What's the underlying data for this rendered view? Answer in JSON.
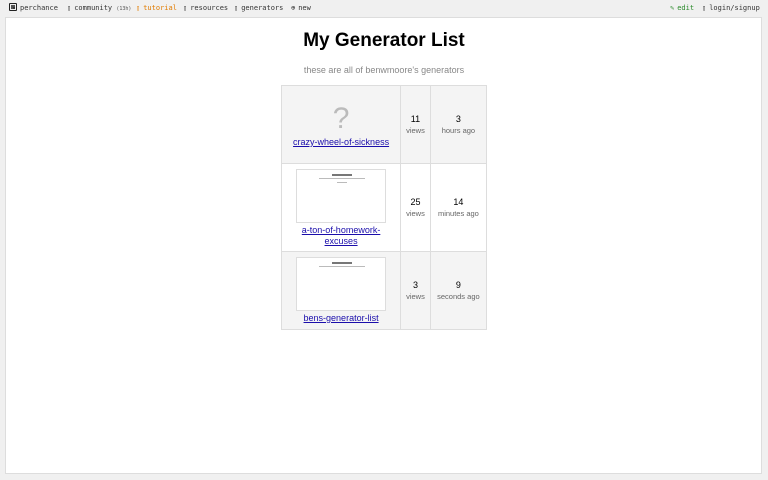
{
  "topbar": {
    "logo_label": "perchance",
    "community_label": "community",
    "community_count": "(13h)",
    "tutorial_label": "tutorial",
    "resources_label": "resources",
    "generators_label": "generators",
    "new_label": "new",
    "edit_label": "edit",
    "login_label": "login/signup",
    "icons": {
      "logo": "dice-icon",
      "community": "chat-icon",
      "tutorial": "book-icon",
      "resources": "list-icon",
      "generators": "list-icon",
      "new": "plus-circle-icon",
      "edit": "pencil-icon",
      "login": "user-icon"
    },
    "colors": {
      "tutorial": "#e07b00",
      "edit": "#2a8a2a"
    }
  },
  "page": {
    "title": "My Generator List",
    "subtitle": "these are all of benwmoore's generators"
  },
  "generators": [
    {
      "thumbnail": "none",
      "thumb_placeholder": "?",
      "name": "crazy-wheel-of-sickness",
      "views": "11",
      "views_label": "views",
      "age": "3",
      "age_label": "hours ago"
    },
    {
      "thumbnail": "screenshot",
      "name": "a-ton-of-homework-excuses",
      "views": "25",
      "views_label": "views",
      "age": "14",
      "age_label": "minutes ago"
    },
    {
      "thumbnail": "screenshot",
      "name": "bens-generator-list",
      "views": "3",
      "views_label": "views",
      "age": "9",
      "age_label": "seconds ago"
    }
  ]
}
